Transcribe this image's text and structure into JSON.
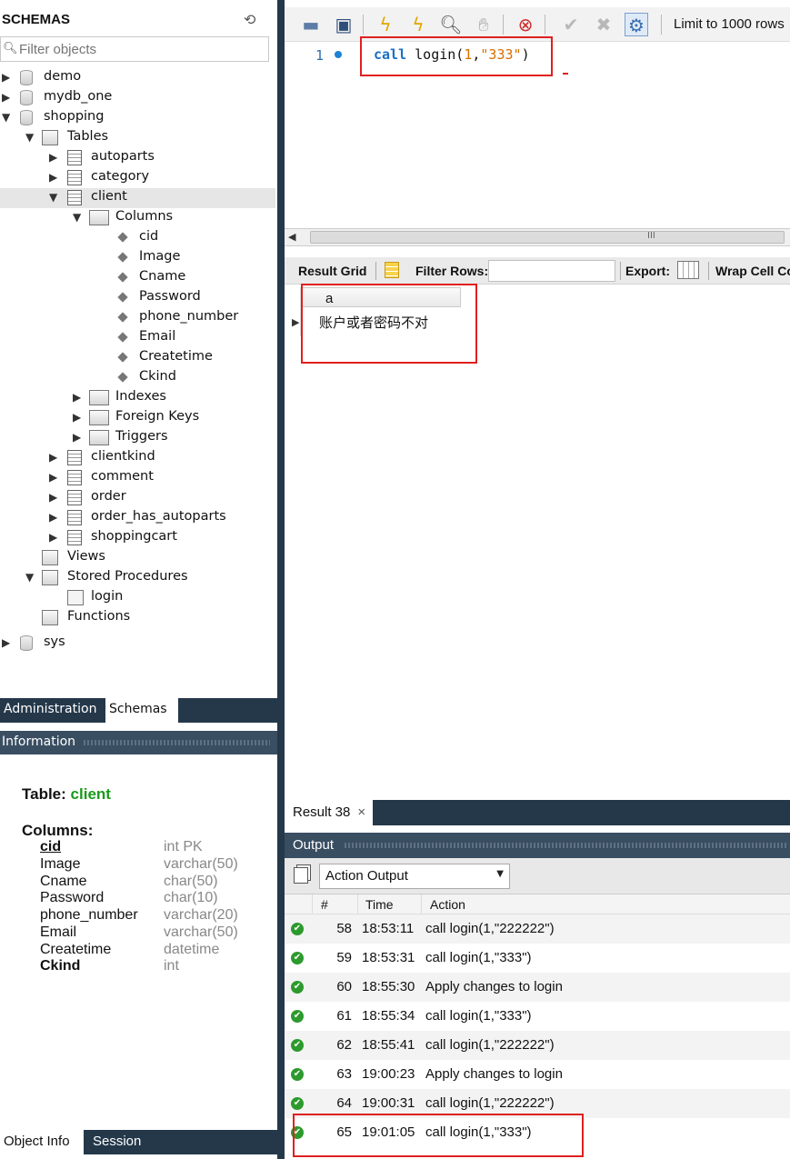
{
  "schemas": {
    "title": "SCHEMAS",
    "filter_placeholder": "Filter objects",
    "tree": [
      {
        "label": "demo"
      },
      {
        "label": "mydb_one"
      },
      {
        "label": "shopping"
      },
      {
        "label": "Tables"
      },
      {
        "label": "autoparts"
      },
      {
        "label": "category"
      },
      {
        "label": "client"
      },
      {
        "label": "Columns"
      },
      {
        "label": "cid"
      },
      {
        "label": "Image"
      },
      {
        "label": "Cname"
      },
      {
        "label": "Password"
      },
      {
        "label": "phone_number"
      },
      {
        "label": "Email"
      },
      {
        "label": "Createtime"
      },
      {
        "label": "Ckind"
      },
      {
        "label": "Indexes"
      },
      {
        "label": "Foreign Keys"
      },
      {
        "label": "Triggers"
      },
      {
        "label": "clientkind"
      },
      {
        "label": "comment"
      },
      {
        "label": "order"
      },
      {
        "label": "order_has_autoparts"
      },
      {
        "label": "shoppingcart"
      },
      {
        "label": "Views"
      },
      {
        "label": "Stored Procedures"
      },
      {
        "label": "login"
      },
      {
        "label": "Functions"
      },
      {
        "label": "sys"
      }
    ]
  },
  "left_tabs": {
    "administration": "Administration",
    "schemas": "Schemas"
  },
  "information": {
    "title": "Information",
    "table_label": "Table:",
    "table_name": "client",
    "columns_label": "Columns:",
    "columns": [
      {
        "name": "cid",
        "type": "int PK"
      },
      {
        "name": "Image",
        "type": "varchar(50)"
      },
      {
        "name": "Cname",
        "type": "char(50)"
      },
      {
        "name": "Password",
        "type": "char(10)"
      },
      {
        "name": "phone_number",
        "type": "varchar(20)"
      },
      {
        "name": "Email",
        "type": "varchar(50)"
      },
      {
        "name": "Createtime",
        "type": "datetime"
      },
      {
        "name": "Ckind",
        "type": "int"
      }
    ]
  },
  "bottom_tabs": {
    "object_info": "Object Info",
    "session": "Session"
  },
  "toolbar": {
    "limit_label": "Limit to 1000 rows"
  },
  "editor": {
    "line_number": "1",
    "code_keyword": "call",
    "code_fn": " login(",
    "code_num": "1",
    "code_comma": ",",
    "code_str": "\"333\"",
    "code_close": ")"
  },
  "result_toolbar": {
    "result_grid": "Result Grid",
    "filter_rows": "Filter Rows:",
    "export": "Export:",
    "wrap_cell": "Wrap Cell Co"
  },
  "grid": {
    "column": "a",
    "value": "账户或者密码不对"
  },
  "result_tab": {
    "label": "Result 38",
    "close": "×"
  },
  "output": {
    "title": "Output",
    "selector": "Action Output",
    "columns": {
      "num": "#",
      "time": "Time",
      "action": "Action"
    },
    "rows": [
      {
        "num": "58",
        "time": "18:53:11",
        "action": "call login(1,\"222222\")"
      },
      {
        "num": "59",
        "time": "18:53:31",
        "action": "call login(1,\"333\")"
      },
      {
        "num": "60",
        "time": "18:55:30",
        "action": "Apply changes to login"
      },
      {
        "num": "61",
        "time": "18:55:34",
        "action": "call login(1,\"333\")"
      },
      {
        "num": "62",
        "time": "18:55:41",
        "action": "call login(1,\"222222\")"
      },
      {
        "num": "63",
        "time": "19:00:23",
        "action": "Apply changes to login"
      },
      {
        "num": "64",
        "time": "19:00:31",
        "action": "call login(1,\"222222\")"
      },
      {
        "num": "65",
        "time": "19:01:05",
        "action": "call login(1,\"333\")"
      }
    ]
  },
  "colors": {
    "panel_dark": "#24384a",
    "accent_green": "#1a9a1a",
    "highlight_red": "#e02020"
  }
}
